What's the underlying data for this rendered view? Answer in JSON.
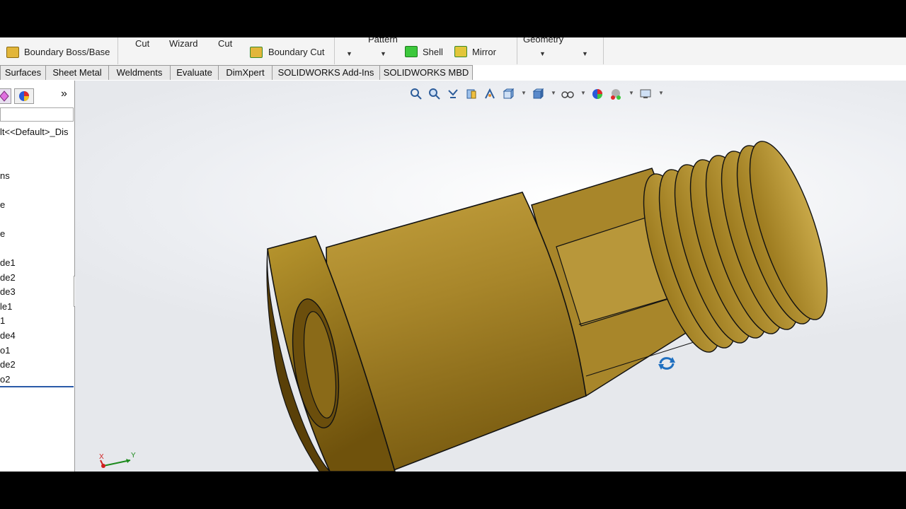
{
  "ribbon": {
    "boundary_boss_base": "Boundary Boss/Base",
    "cut_label_1": "Cut",
    "wizard_label": "Wizard",
    "cut_label_2": "Cut",
    "boundary_cut": "Boundary Cut",
    "pattern_label": "Pattern",
    "shell_label": "Shell",
    "mirror_label": "Mirror",
    "geometry_label": "Geometry"
  },
  "tabs": [
    "Surfaces",
    "Sheet Metal",
    "Weldments",
    "Evaluate",
    "DimXpert",
    "SOLIDWORKS Add-Ins",
    "SOLIDWORKS MBD"
  ],
  "feature_tree": {
    "expand_glyph": "»",
    "config_row": "lt<<Default>_Dis",
    "items": [
      "ns",
      "e",
      "e",
      "de1",
      "de2",
      "de3",
      "le1",
      "1",
      "de4",
      "o1",
      "de2",
      "o2"
    ]
  },
  "triad": {
    "x_label": "X",
    "y_label": "Y"
  },
  "colors": {
    "part_brass": "#a8862a",
    "ribbon_bg": "#f4f4f4",
    "view_icon": "#2c5c9a"
  },
  "view_toolbar_icons": [
    "zoom-to-fit-icon",
    "zoom-to-area-icon",
    "previous-view-icon",
    "section-view-icon",
    "dynamic-annotation-icon",
    "view-orientation-icon",
    "display-style-icon",
    "hide-show-items-icon",
    "edit-appearance-icon",
    "apply-scene-icon",
    "view-settings-icon"
  ]
}
